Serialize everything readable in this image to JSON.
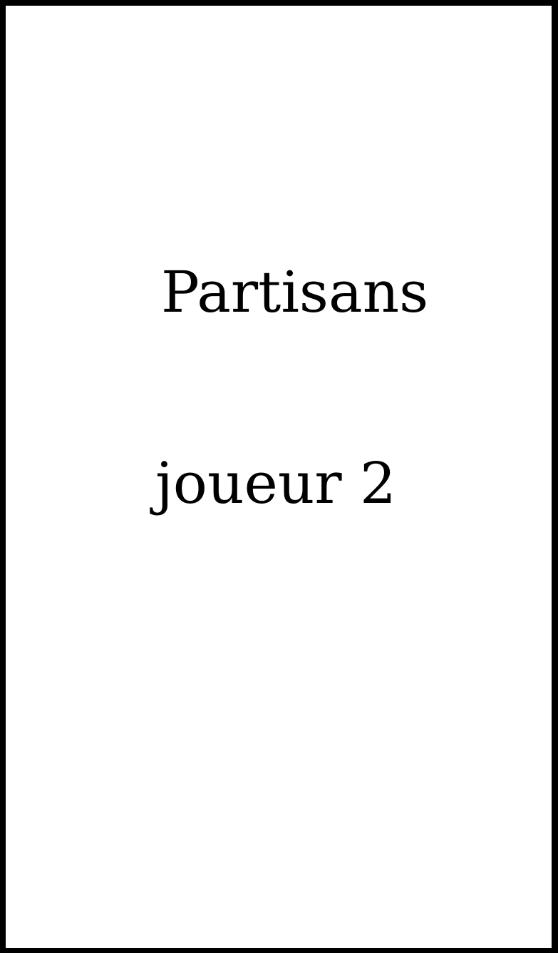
{
  "card": {
    "title": "Partisans",
    "player": "joueur 2",
    "colors": {
      "background": "#ffffff",
      "border": "#000000",
      "text": "#000000"
    }
  }
}
